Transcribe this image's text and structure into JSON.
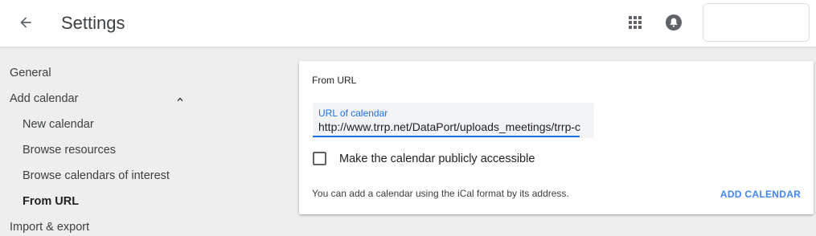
{
  "header": {
    "title": "Settings",
    "back_icon": "arrow-back-icon",
    "apps_icon": "apps-grid-icon",
    "notifications_icon": "notifications-icon"
  },
  "sidebar": {
    "items": [
      {
        "label": "General"
      },
      {
        "label": "Add calendar",
        "expanded": true
      },
      {
        "label": "New calendar"
      },
      {
        "label": "Browse resources"
      },
      {
        "label": "Browse calendars of interest"
      },
      {
        "label": "From URL",
        "selected": true
      },
      {
        "label": "Import & export"
      }
    ]
  },
  "card": {
    "title": "From URL",
    "url_field": {
      "label": "URL of calendar",
      "value": "http://www.trrp.net/DataPort/uploads_meetings/trrp-c"
    },
    "checkbox": {
      "label": "Make the calendar publicly accessible",
      "checked": false
    },
    "hint": "You can add a calendar using the iCal format by its address.",
    "add_button": "ADD CALENDAR"
  },
  "colors": {
    "accent": "#1a73e8",
    "button_text": "#4285f4",
    "background": "#eeeeee"
  }
}
